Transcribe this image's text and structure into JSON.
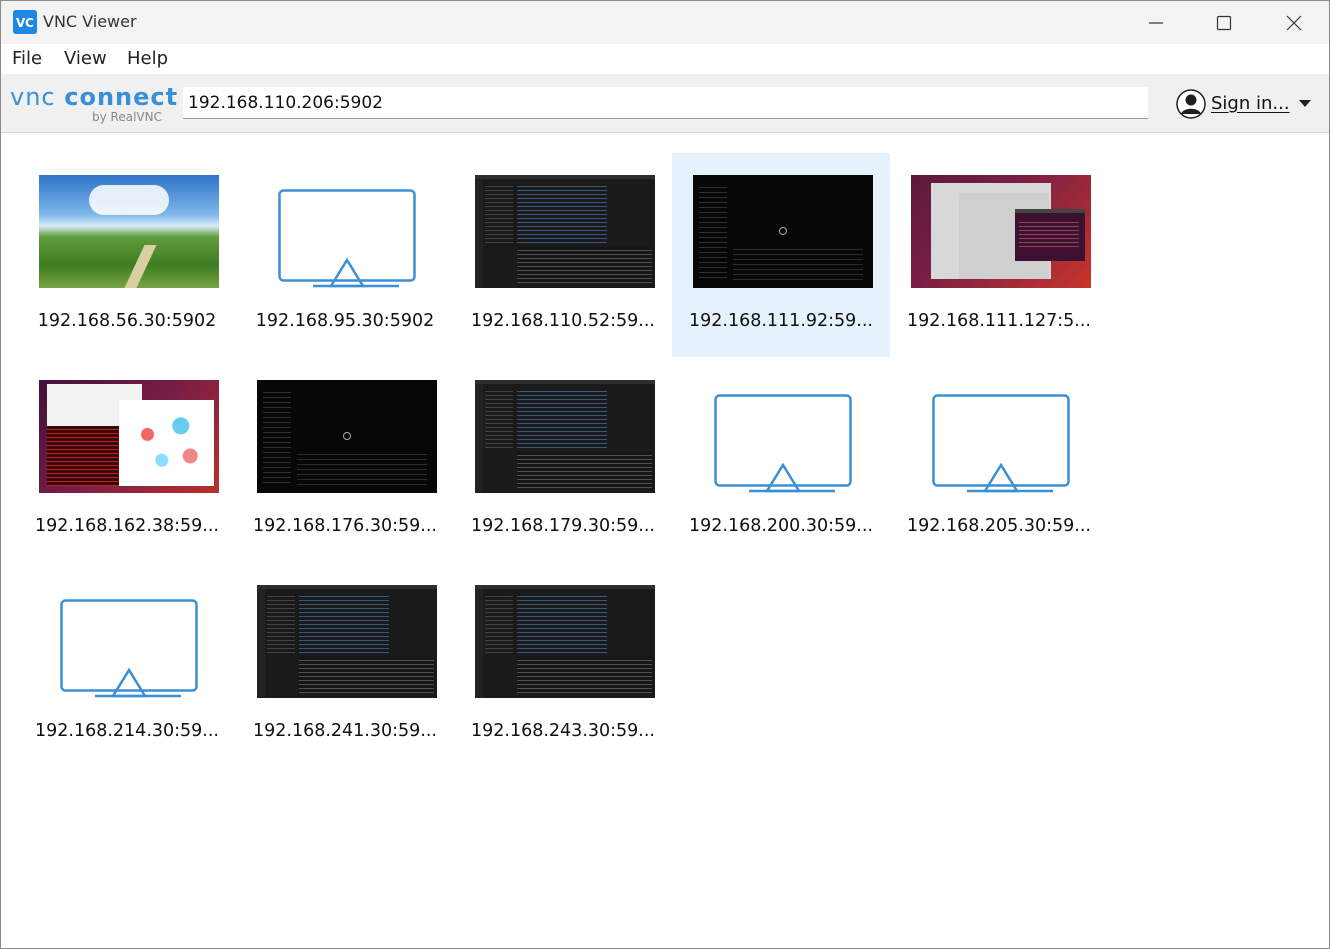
{
  "window": {
    "title": "VNC Viewer",
    "app_icon": "vnc-app-icon",
    "app_icon_text": "V͏C"
  },
  "menu": [
    "File",
    "View",
    "Help"
  ],
  "toolbar": {
    "logo_main_a": "vnc",
    "logo_main_b": "connect",
    "logo_sub": "by RealVNC",
    "address_value": "192.168.110.206:5902",
    "signin_label": "Sign in..."
  },
  "colors": {
    "accent": "#3b8fd6",
    "selected_bg": "#e5f1fb",
    "monitor_stroke": "#3b8fd6"
  },
  "connections": [
    {
      "label": "192.168.56.30:5902",
      "thumb": "landscape",
      "selected": false
    },
    {
      "label": "192.168.95.30:5902",
      "thumb": "monitor-icon",
      "selected": false
    },
    {
      "label": "192.168.110.52:59...",
      "thumb": "dark-editor",
      "selected": false
    },
    {
      "label": "192.168.111.92:59...",
      "thumb": "black-editor",
      "selected": true
    },
    {
      "label": "192.168.111.127:5...",
      "thumb": "ubuntu-desktop",
      "selected": false
    },
    {
      "label": "192.168.162.38:59...",
      "thumb": "ubuntu-desktop-2",
      "selected": false
    },
    {
      "label": "192.168.176.30:59...",
      "thumb": "black-editor",
      "selected": false
    },
    {
      "label": "192.168.179.30:59...",
      "thumb": "dark-editor",
      "selected": false
    },
    {
      "label": "192.168.200.30:59...",
      "thumb": "monitor-icon",
      "selected": false
    },
    {
      "label": "192.168.205.30:59...",
      "thumb": "monitor-icon",
      "selected": false
    },
    {
      "label": "192.168.214.30:59...",
      "thumb": "monitor-icon",
      "selected": false
    },
    {
      "label": "192.168.241.30:59...",
      "thumb": "dark-editor",
      "selected": false
    },
    {
      "label": "192.168.243.30:59...",
      "thumb": "dark-editor",
      "selected": false
    }
  ]
}
